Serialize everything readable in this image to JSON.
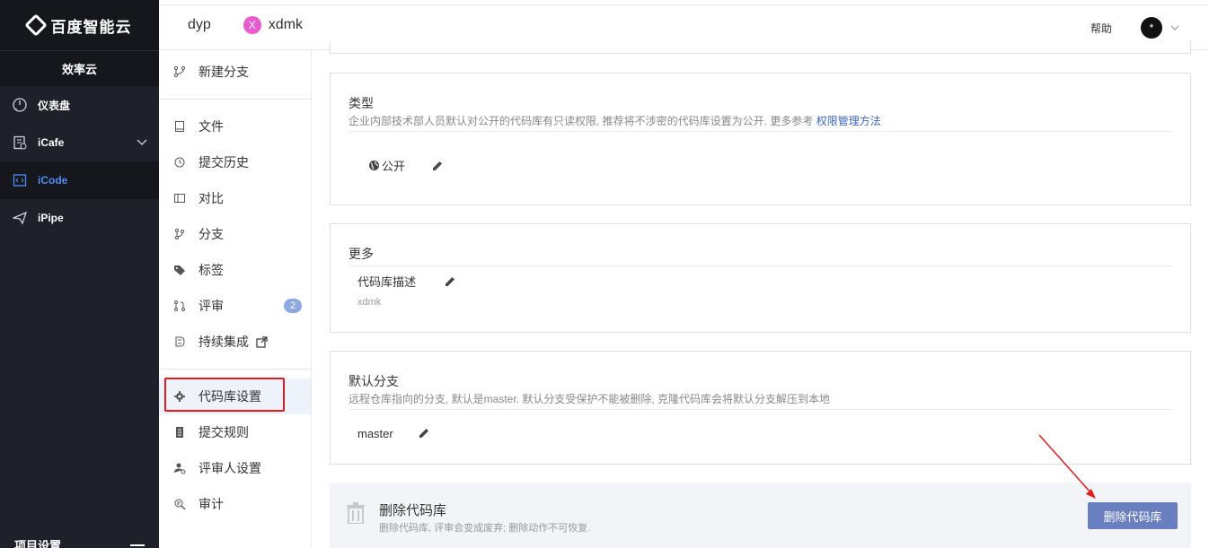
{
  "nav": {
    "logo": "百度智能云",
    "product": "效率云",
    "items": [
      {
        "label": "仪表盘"
      },
      {
        "label": "iCafe"
      },
      {
        "label": "iCode"
      },
      {
        "label": "iPipe"
      }
    ],
    "bottom_label": "项目设置"
  },
  "topbar": {
    "workspace": "dyp",
    "repo_badge": "X",
    "repo": "xdmk",
    "help": "帮助",
    "avatar": "*"
  },
  "submenu": {
    "new_branch": "新建分支",
    "items": [
      {
        "label": "文件"
      },
      {
        "label": "提交历史"
      },
      {
        "label": "对比"
      },
      {
        "label": "分支"
      },
      {
        "label": "标签"
      },
      {
        "label": "评审",
        "badge": "2"
      },
      {
        "label": "持续集成"
      }
    ],
    "settings": [
      {
        "label": "代码库设置"
      },
      {
        "label": "提交规则"
      },
      {
        "label": "评审人设置"
      },
      {
        "label": "审计"
      }
    ]
  },
  "main": {
    "type_card": {
      "title": "类型",
      "desc": "企业内部技术部人员默认对公开的代码库有只读权限, 推荐将不涉密的代码库设置为公开. 更多参考",
      "desc_link": "权限管理方法",
      "value": "公开"
    },
    "more_card": {
      "title": "更多",
      "field_label": "代码库描述",
      "field_value": "xdmk"
    },
    "branch_card": {
      "title": "默认分支",
      "desc": "远程仓库指向的分支, 默认是master. 默认分支受保护不能被删除, 克隆代码库会将默认分支解压到本地",
      "value": "master"
    },
    "danger": {
      "title": "删除代码库",
      "desc": "删除代码库, 评审会变成废弃; 删除动作不可恢复.",
      "button": "删除代码库"
    }
  },
  "colors": {
    "sidebar_bg": "#1e2129",
    "active_blue": "#4e8df5",
    "delete_button": "#6a7fc0",
    "highlight_red": "#e21b1b"
  }
}
